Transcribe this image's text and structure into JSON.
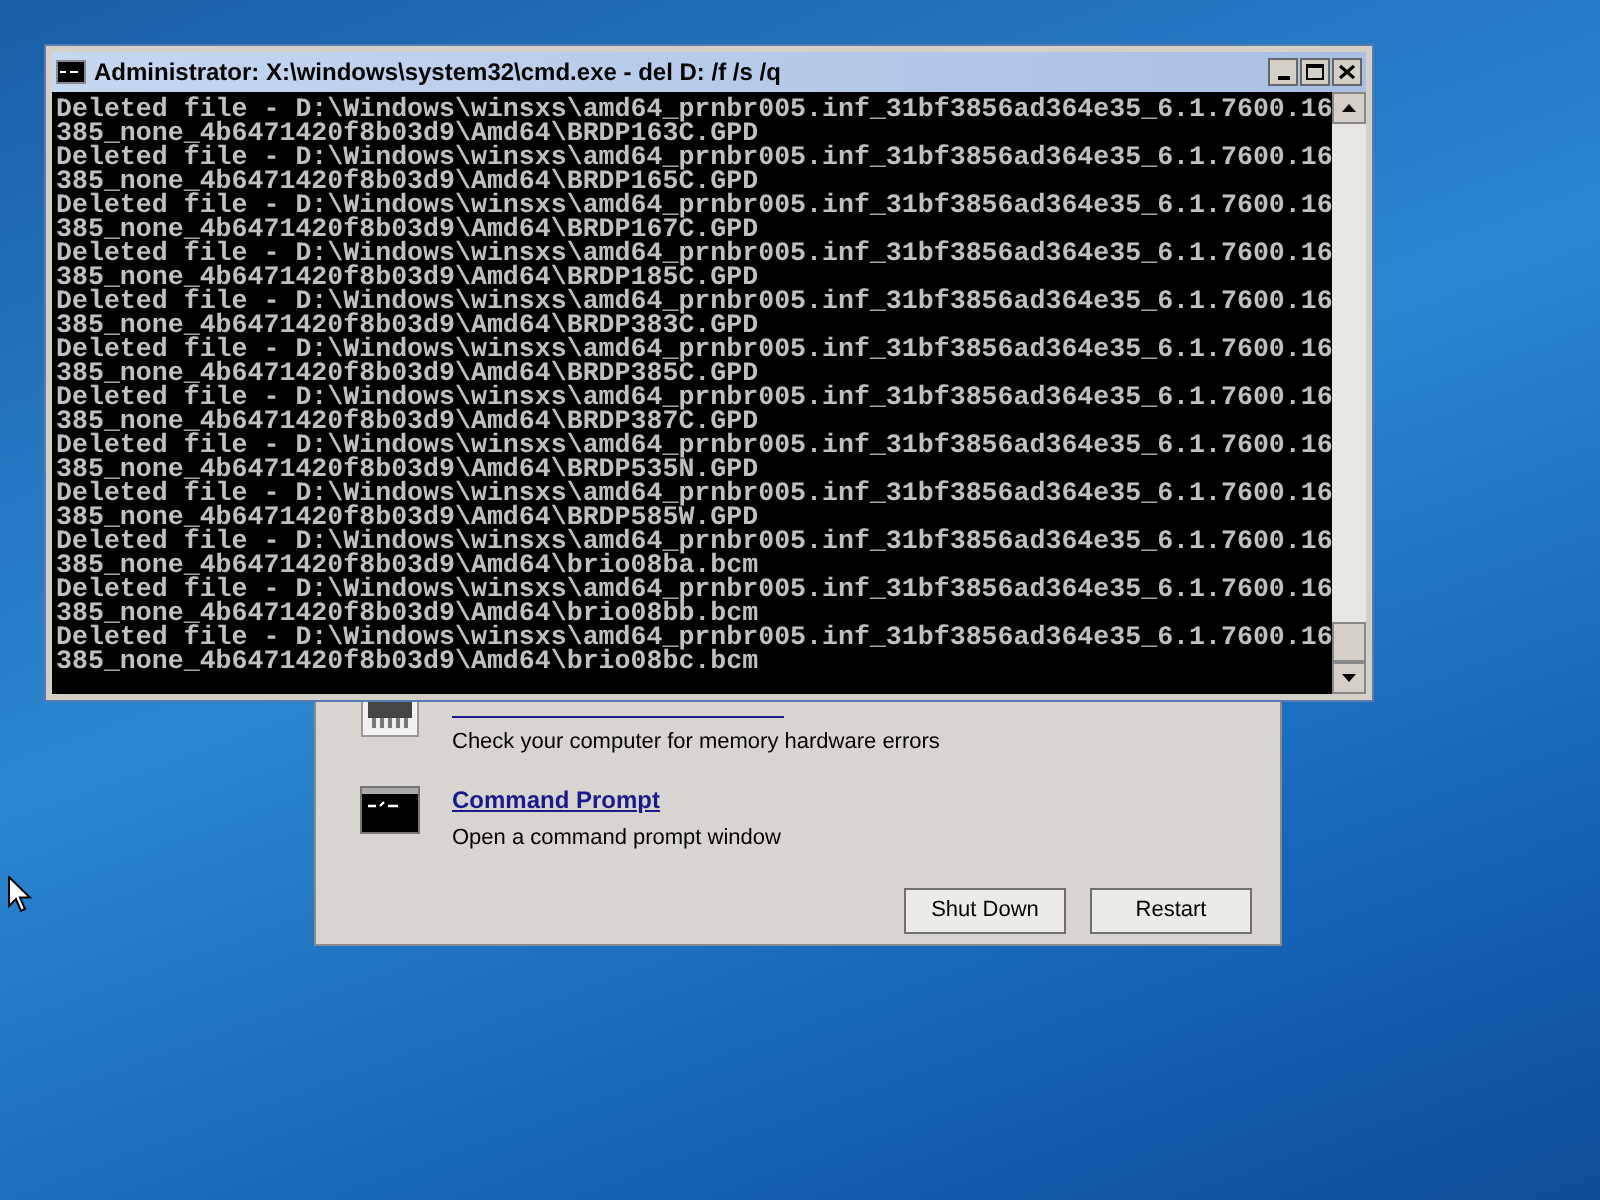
{
  "console_window": {
    "title": "Administrator: X:\\windows\\system32\\cmd.exe - del  D: /f /s /q",
    "lines": [
      "Deleted file - D:\\Windows\\winsxs\\amd64_prnbr005.inf_31bf3856ad364e35_6.1.7600.16",
      "385_none_4b6471420f8b03d9\\Amd64\\BRDP163C.GPD",
      "Deleted file - D:\\Windows\\winsxs\\amd64_prnbr005.inf_31bf3856ad364e35_6.1.7600.16",
      "385_none_4b6471420f8b03d9\\Amd64\\BRDP165C.GPD",
      "Deleted file - D:\\Windows\\winsxs\\amd64_prnbr005.inf_31bf3856ad364e35_6.1.7600.16",
      "385_none_4b6471420f8b03d9\\Amd64\\BRDP167C.GPD",
      "Deleted file - D:\\Windows\\winsxs\\amd64_prnbr005.inf_31bf3856ad364e35_6.1.7600.16",
      "385_none_4b6471420f8b03d9\\Amd64\\BRDP185C.GPD",
      "Deleted file - D:\\Windows\\winsxs\\amd64_prnbr005.inf_31bf3856ad364e35_6.1.7600.16",
      "385_none_4b6471420f8b03d9\\Amd64\\BRDP383C.GPD",
      "Deleted file - D:\\Windows\\winsxs\\amd64_prnbr005.inf_31bf3856ad364e35_6.1.7600.16",
      "385_none_4b6471420f8b03d9\\Amd64\\BRDP385C.GPD",
      "Deleted file - D:\\Windows\\winsxs\\amd64_prnbr005.inf_31bf3856ad364e35_6.1.7600.16",
      "385_none_4b6471420f8b03d9\\Amd64\\BRDP387C.GPD",
      "Deleted file - D:\\Windows\\winsxs\\amd64_prnbr005.inf_31bf3856ad364e35_6.1.7600.16",
      "385_none_4b6471420f8b03d9\\Amd64\\BRDP535N.GPD",
      "Deleted file - D:\\Windows\\winsxs\\amd64_prnbr005.inf_31bf3856ad364e35_6.1.7600.16",
      "385_none_4b6471420f8b03d9\\Amd64\\BRDP585W.GPD",
      "Deleted file - D:\\Windows\\winsxs\\amd64_prnbr005.inf_31bf3856ad364e35_6.1.7600.16",
      "385_none_4b6471420f8b03d9\\Amd64\\brio08ba.bcm",
      "Deleted file - D:\\Windows\\winsxs\\amd64_prnbr005.inf_31bf3856ad364e35_6.1.7600.16",
      "385_none_4b6471420f8b03d9\\Amd64\\brio08bb.bcm",
      "Deleted file - D:\\Windows\\winsxs\\amd64_prnbr005.inf_31bf3856ad364e35_6.1.7600.16",
      "385_none_4b6471420f8b03d9\\Amd64\\brio08bc.bcm"
    ]
  },
  "recovery_dialog": {
    "tools": [
      {
        "kind": "memory",
        "description": "Check your computer for memory hardware errors"
      },
      {
        "kind": "console",
        "name": "Command Prompt",
        "description": "Open a command prompt window"
      }
    ],
    "buttons": [
      "Shut Down",
      "Restart"
    ]
  }
}
